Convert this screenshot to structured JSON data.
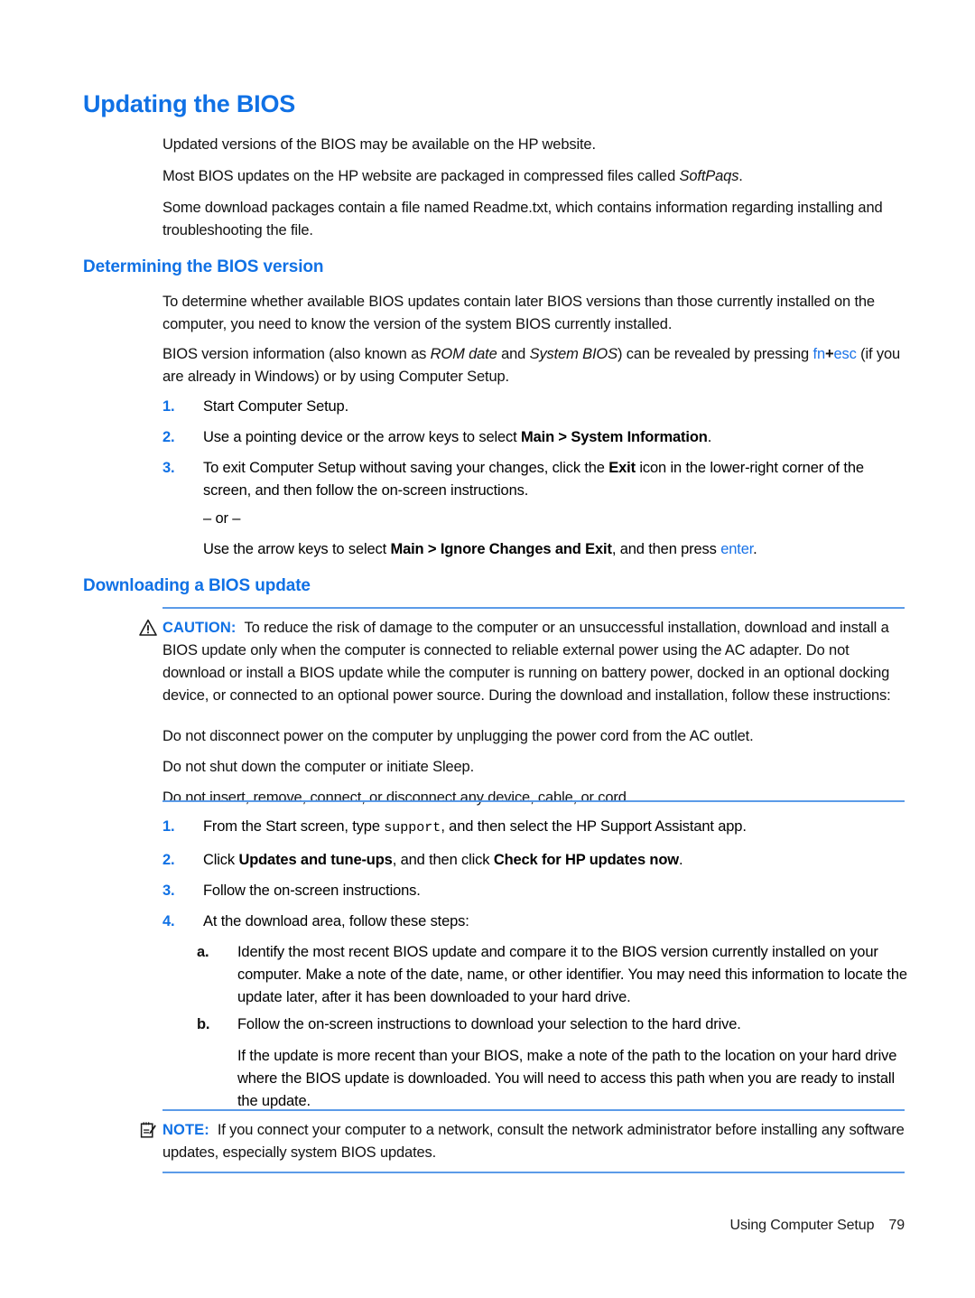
{
  "document": {
    "title": "Updating the BIOS",
    "footer": {
      "section": "Using Computer Setup",
      "page_number": "79"
    }
  },
  "intro": {
    "p1": "Updated versions of the BIOS may be available on the HP website.",
    "p2_before": "Most BIOS updates on the HP website are packaged in compressed files called ",
    "p2_italic": "SoftPaqs",
    "p2_after": ".",
    "p3": "Some download packages contain a file named Readme.txt, which contains information regarding installing and troubleshooting the file."
  },
  "determining": {
    "heading": "Determining the BIOS version",
    "p1": "To determine whether available BIOS updates contain later BIOS versions than those currently installed on the computer, you need to know the version of the system BIOS currently installed.",
    "p2_a": "BIOS version information (also known as ",
    "p2_italic1": "ROM date",
    "p2_b": " and ",
    "p2_italic2": "System BIOS",
    "p2_c": ") can be revealed by pressing ",
    "p2_key1": "fn",
    "p2_plus": "+",
    "p2_key2": "esc",
    "p2_d": " (if you are already in Windows) or by using Computer Setup.",
    "steps": [
      {
        "marker": "1.",
        "text": "Start Computer Setup."
      },
      {
        "marker": "2.",
        "text_before": "Use a pointing device or the arrow keys to select ",
        "bold": "Main > System Information",
        "text_after": "."
      },
      {
        "marker": "3.",
        "text_before": "To exit Computer Setup without saving your changes, click the ",
        "bold": "Exit",
        "text_after": " icon in the lower-right corner of the screen, and then follow the on-screen instructions.",
        "or_divider": "– or –",
        "alt_before": "Use the arrow keys to select ",
        "alt_bold": "Main > Ignore Changes and Exit",
        "alt_mid": ", and then press ",
        "alt_key": "enter",
        "alt_after": "."
      }
    ]
  },
  "downloading": {
    "heading": "Downloading a BIOS update",
    "caution": {
      "icon": "warning-triangle-icon",
      "tag": "CAUTION:",
      "body": "To reduce the risk of damage to the computer or an unsuccessful installation, download and install a BIOS update only when the computer is connected to reliable external power using the AC adapter. Do not download or install a BIOS update while the computer is running on battery power, docked in an optional docking device, or connected to an optional power source. During the download and installation, follow these instructions:",
      "bullets": [
        "Do not disconnect power on the computer by unplugging the power cord from the AC outlet.",
        "Do not shut down the computer or initiate Sleep.",
        "Do not insert, remove, connect, or disconnect any device, cable, or cord."
      ]
    },
    "steps": [
      {
        "marker": "1.",
        "text_before": "From the Start screen, type ",
        "mono": "support",
        "text_after": ", and then select the HP Support Assistant app."
      },
      {
        "marker": "2.",
        "text_before": "Click ",
        "bold1": "Updates and tune-ups",
        "text_mid": ", and then click ",
        "bold2": "Check for HP updates now",
        "text_after": "."
      },
      {
        "marker": "3.",
        "text": "Follow the on-screen instructions."
      },
      {
        "marker": "4.",
        "text": "At the download area, follow these steps:"
      }
    ],
    "substeps": [
      {
        "marker": "a.",
        "text": "Identify the most recent BIOS update and compare it to the BIOS version currently installed on your computer. Make a note of the date, name, or other identifier. You may need this information to locate the update later, after it has been downloaded to your hard drive."
      },
      {
        "marker": "b.",
        "text": "Follow the on-screen instructions to download your selection to the hard drive.",
        "followup": "If the update is more recent than your BIOS, make a note of the path to the location on your hard drive where the BIOS update is downloaded. You will need to access this path when you are ready to install the update."
      }
    ],
    "note": {
      "icon": "notepad-pencil-icon",
      "tag": "NOTE:",
      "body": "If you connect your computer to a network, consult the network administrator before installing any software updates, especially system BIOS updates."
    }
  },
  "colors": {
    "heading_blue": "#1071E5",
    "rule_blue": "#5B9BE8",
    "link_blue": "#1A73E8",
    "text_black": "#111111"
  }
}
